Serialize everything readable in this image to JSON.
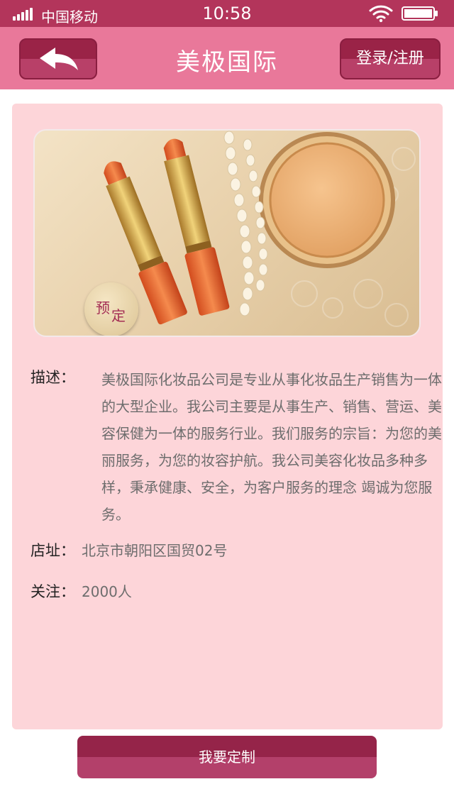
{
  "status_bar": {
    "carrier": "中国移动",
    "time": "10:58"
  },
  "nav": {
    "title": "美极国际",
    "login_label": "登录/注册",
    "back_icon": "back-arrow-icon"
  },
  "product": {
    "badge_char_1": "预",
    "badge_char_2": "定",
    "description_label": "描述：",
    "description": "美极国际化妆品公司是专业从事化妆品生产销售为一体的大型企业。我公司主要是从事生产、销售、营运、美容保健为一体的服务行业。我们服务的宗旨：为您的美丽服务，为您的妆容护航。我公司美容化妆品多种多样，秉承健康、安全，为客户服务的理念 竭诚为您服务。",
    "address_label": "店址：",
    "address": "北京市朝阳区国贸02号",
    "followers_label": "关注：",
    "followers": "2000人"
  },
  "footer": {
    "custom_label": "我要定制"
  },
  "colors": {
    "status_bar": "#b3355b",
    "nav_bar": "#e9789a",
    "card": "#fdd5d9",
    "button": "#952449"
  }
}
